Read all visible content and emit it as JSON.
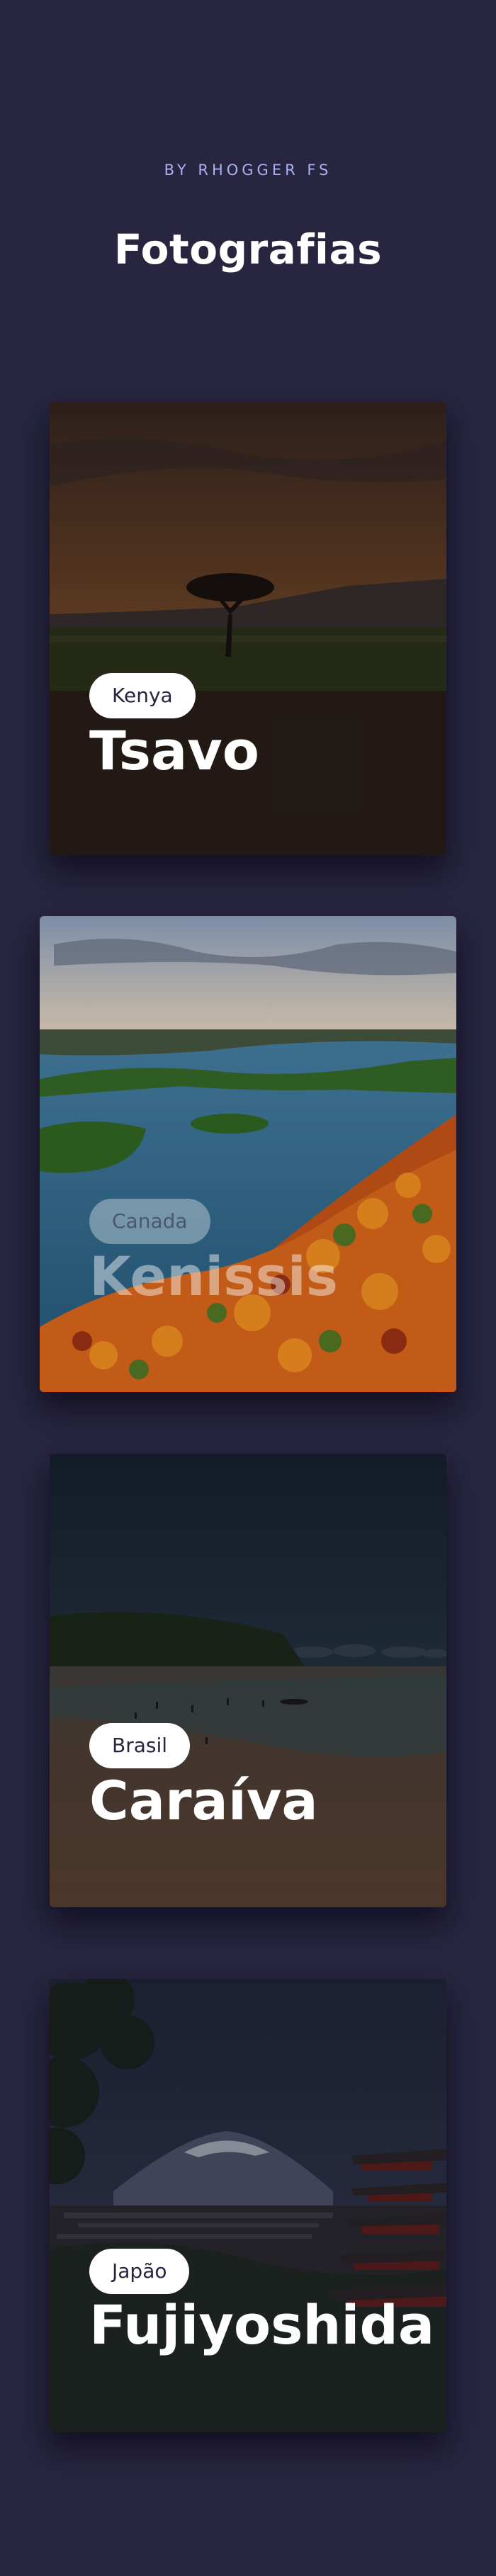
{
  "header": {
    "byline": "BY RHOGGER FS",
    "title": "Fotografias"
  },
  "cards": [
    {
      "country": "Kenya",
      "place": "Tsavo"
    },
    {
      "country": "Canada",
      "place": "Kenissis"
    },
    {
      "country": "Brasil",
      "place": "Caraíva"
    },
    {
      "country": "Japão",
      "place": "Fujiyoshida"
    }
  ],
  "colors": {
    "background": "#27253f",
    "byline": "#aab1ee",
    "title": "#ffffff",
    "badge_bg": "#ffffff",
    "badge_text": "#27253f"
  }
}
